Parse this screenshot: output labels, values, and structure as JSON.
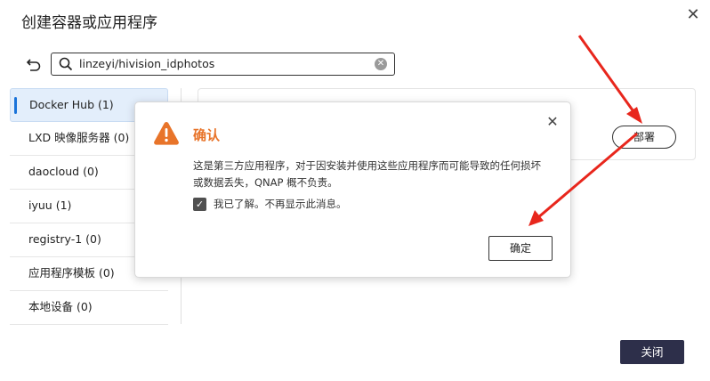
{
  "window": {
    "title": "创建容器或应用程序"
  },
  "search": {
    "value": "linzeyi/hivision_idphotos"
  },
  "sidebar": {
    "items": [
      {
        "label": "Docker Hub (1)",
        "active": true
      },
      {
        "label": "LXD 映像服务器 (0)",
        "active": false
      },
      {
        "label": "daocloud (0)",
        "active": false
      },
      {
        "label": "iyuu (1)",
        "active": false
      },
      {
        "label": "registry-1 (0)",
        "active": false
      },
      {
        "label": "应用程序模板 (0)",
        "active": false
      },
      {
        "label": "本地设备 (0)",
        "active": false
      }
    ]
  },
  "result": {
    "deploy_label": "部署"
  },
  "footer": {
    "close_label": "关闭"
  },
  "dialog": {
    "title": "确认",
    "message": "这是第三方应用程序，对于因安装并使用这些应用程序而可能导致的任何损坏或数据丢失，QNAP 概不负责。",
    "checkbox_label": "我已了解。不再显示此消息。",
    "checkbox_checked": true,
    "ok_label": "确定"
  },
  "colors": {
    "accent": "#1a73d9",
    "warning": "#e8742a",
    "annotation_arrow": "#e8261c",
    "primary_button": "#2d2f4a"
  }
}
